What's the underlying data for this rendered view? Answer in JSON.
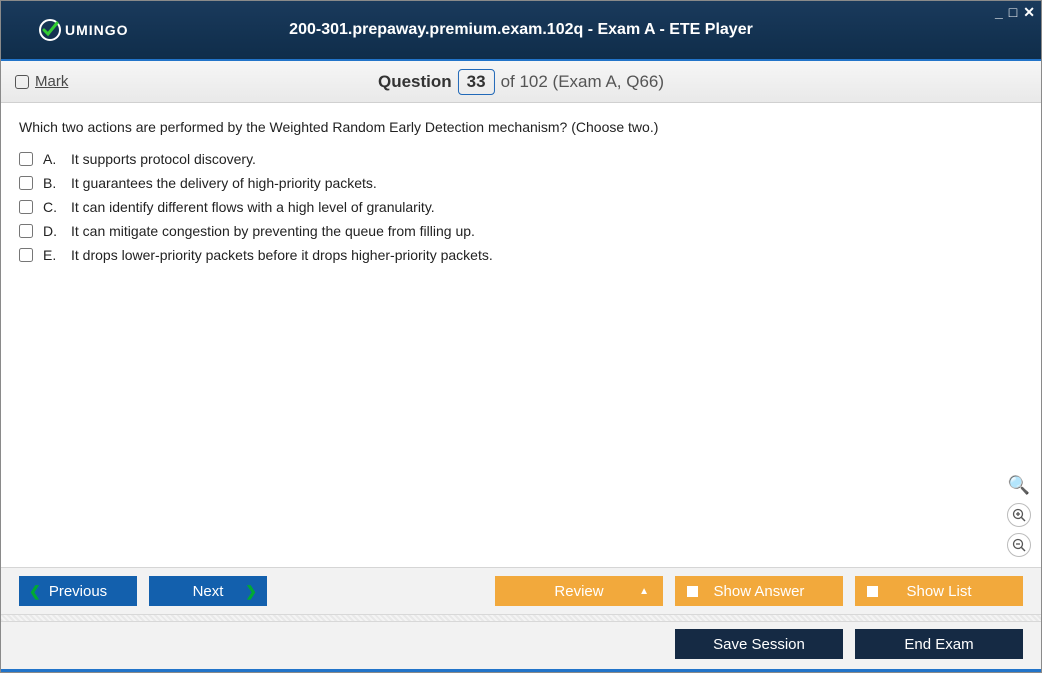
{
  "window": {
    "title": "200-301.prepaway.premium.exam.102q - Exam A - ETE Player",
    "logo_text": "UMINGO"
  },
  "header": {
    "mark_label": "Mark",
    "question_label": "Question",
    "current_num": "33",
    "of_text": "of 102 (Exam A, Q66)"
  },
  "question": {
    "text": "Which two actions are performed by the Weighted Random Early Detection mechanism? (Choose two.)",
    "options": [
      {
        "letter": "A.",
        "text": "It supports protocol discovery."
      },
      {
        "letter": "B.",
        "text": "It guarantees the delivery of high-priority packets."
      },
      {
        "letter": "C.",
        "text": "It can identify different flows with a high level of granularity."
      },
      {
        "letter": "D.",
        "text": "It can mitigate congestion by preventing the queue from filling up."
      },
      {
        "letter": "E.",
        "text": "It drops lower-priority packets before it drops higher-priority packets."
      }
    ]
  },
  "buttons": {
    "previous": "Previous",
    "next": "Next",
    "review": "Review",
    "show_answer": "Show Answer",
    "show_list": "Show List",
    "save_session": "Save Session",
    "end_exam": "End Exam"
  }
}
